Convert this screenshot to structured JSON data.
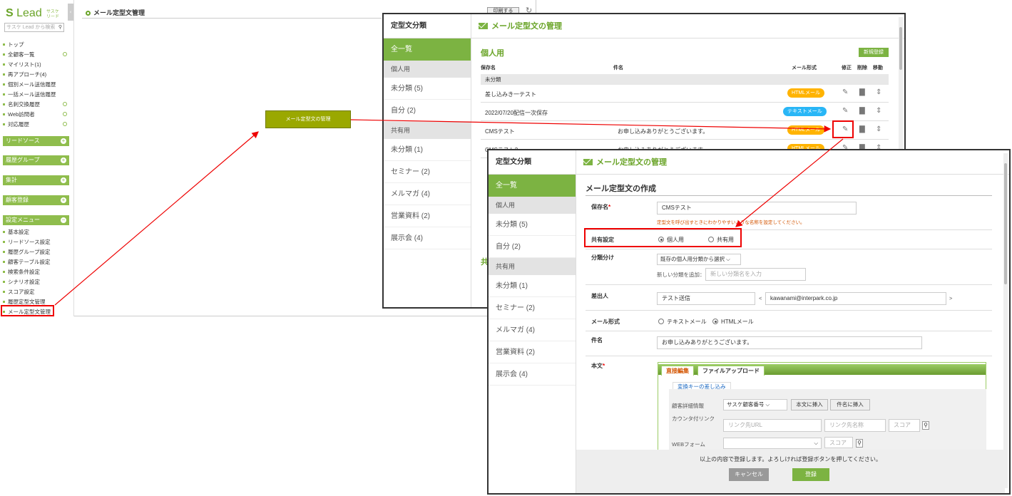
{
  "sidebar": {
    "logo": "Lead",
    "logo_sub": "サスケリード",
    "search_placeholder": "サスケ Lead から検索",
    "items": [
      "トップ",
      "全顧客一覧",
      "マイリスト(1)",
      "再アプローチ(4)",
      "個別メール送信履歴",
      "一括メール送信履歴",
      "名刺交換履歴",
      "Web訪問者",
      "対応履歴"
    ],
    "sections": [
      "リードソース",
      "履歴グループ",
      "集計",
      "顧客登録",
      "設定メニュー"
    ],
    "settings": [
      "基本設定",
      "リードソース設定",
      "履歴グループ設定",
      "顧客テーブル設定",
      "検索条件設定",
      "シナリオ設定",
      "スコア設定",
      "履歴定型文管理",
      "メール定型文管理"
    ]
  },
  "main": {
    "title": "メール定型文管理",
    "print": "印刷する",
    "mgmt_button": "メール定型文の管理"
  },
  "window1": {
    "cat_head": "定型文分類",
    "all": "全一覧",
    "personal": "個人用",
    "shared": "共有用",
    "personal_items": [
      "未分類 (5)",
      "自分 (2)"
    ],
    "shared_items": [
      "未分類 (1)",
      "セミナー (2)",
      "メルマガ (4)",
      "営業資料 (2)",
      "展示会 (4)"
    ],
    "title": "メール定型文の管理",
    "section": "個人用",
    "new_btn": "新規登録",
    "cols": [
      "保存名",
      "件名",
      "メール形式",
      "修正",
      "削除",
      "移動"
    ],
    "group_unclassified": "未分類",
    "rows": [
      {
        "name": "差し込みき一テスト",
        "subject": "",
        "format": "HTMLメール",
        "type": "html"
      },
      {
        "name": "2022/07/20配信一次保存",
        "subject": "",
        "format": "テキストメール",
        "type": "text"
      },
      {
        "name": "CMSテスト",
        "subject": "お申し込みありがとうございます。",
        "format": "HTMLメール",
        "type": "html"
      },
      {
        "name": "CMSテスト2",
        "subject": "お申し込みありがとうございます",
        "format": "HTMLメール",
        "type": "html"
      }
    ],
    "lower_section": "共"
  },
  "window2": {
    "cat_head": "定型文分類",
    "all": "全一覧",
    "personal": "個人用",
    "shared": "共有用",
    "personal_items": [
      "未分類 (5)",
      "自分 (2)"
    ],
    "shared_items": [
      "未分類 (1)",
      "セミナー (2)",
      "メルマガ (4)",
      "営業資料 (2)",
      "展示会 (4)"
    ],
    "title": "メール定型文の管理",
    "form_title": "メール定型文の作成",
    "save_name_label": "保存名",
    "save_name_value": "CMSテスト",
    "save_name_hint": "定型文を呼び出すときにわかりやすいような名称を設定してください。",
    "share_label": "共有設定",
    "share_personal": "個人用",
    "share_shared": "共有用",
    "class_label": "分類分け",
    "class_select": "既存の個人用分類から選択",
    "class_new_label": "新しい分類を追加：",
    "class_new_placeholder": "新しい分類名を入力",
    "sender_label": "差出人",
    "sender_name": "テスト送信",
    "sender_email": "kawanami@interpark.co.jp",
    "lt": "<",
    "gt": ">",
    "format_label": "メール形式",
    "format_text": "テキストメール",
    "format_html": "HTMLメール",
    "subject_label": "件名",
    "subject_value": "お申し込みありがとうございます。",
    "body_label": "本文",
    "tab_direct": "直接編集",
    "tab_upload": "ファイルアップロード",
    "conv_tab": "変換キーの差し込み",
    "cust_label": "顧客詳細情報",
    "cust_select": "サスケ顧客番号",
    "insert_body": "本文に挿入",
    "insert_subject": "件名に挿入",
    "counter_label": "カウンタ付リンク",
    "link_url_ph": "リンク先URL",
    "link_name_ph": "リンク先名称",
    "score_ph": "スコア",
    "web_label": "WEBフォーム",
    "score_ph2": "スコア",
    "confirm": "以上の内容で登録します。よろしければ登録ボタンを押してください。",
    "cancel": "キャンセル",
    "register": "登録"
  }
}
